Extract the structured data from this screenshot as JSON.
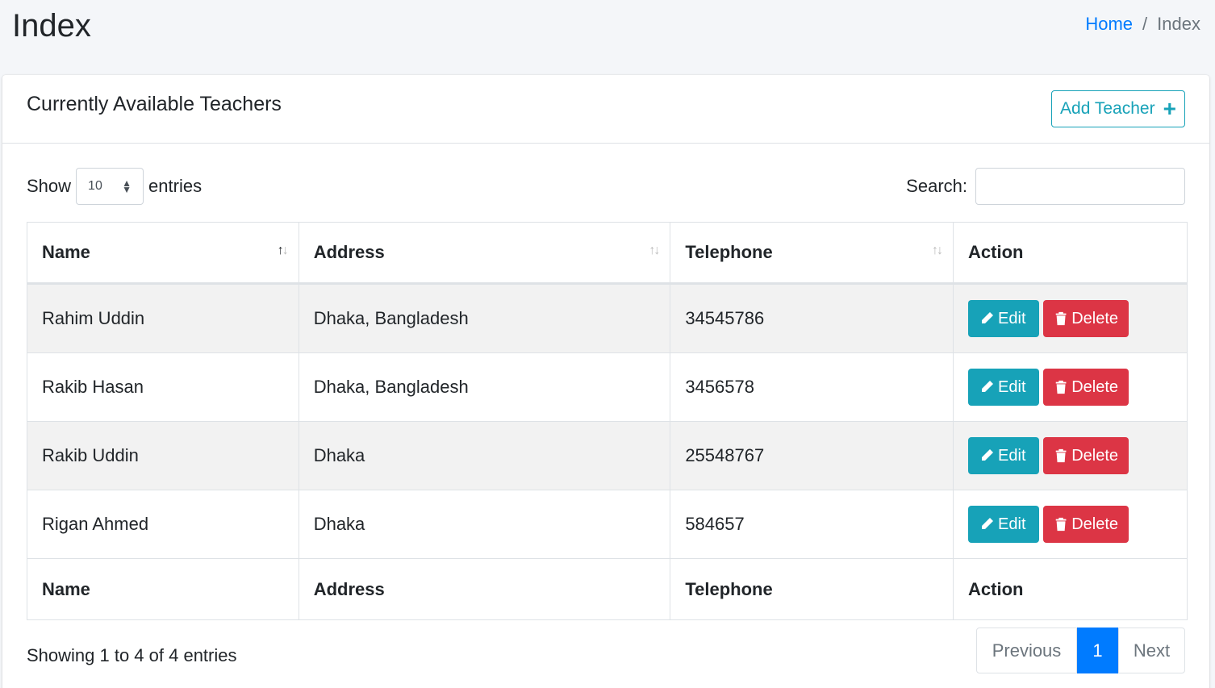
{
  "page": {
    "title": "Index"
  },
  "breadcrumb": {
    "home": "Home",
    "separator": "/",
    "current": "Index"
  },
  "card": {
    "title": "Currently Available Teachers",
    "add_button": "Add Teacher",
    "add_icon": "plus-icon"
  },
  "controls": {
    "show_label": "Show",
    "entries_value": "10",
    "entries_label": "entries",
    "search_label": "Search:",
    "search_value": ""
  },
  "table": {
    "columns": [
      "Name",
      "Address",
      "Telephone",
      "Action"
    ],
    "sort": {
      "column": "Name",
      "direction": "ascending"
    },
    "rows": [
      {
        "name": "Rahim Uddin",
        "address": "Dhaka, Bangladesh",
        "telephone": "34545786"
      },
      {
        "name": "Rakib Hasan",
        "address": "Dhaka, Bangladesh",
        "telephone": "3456578"
      },
      {
        "name": "Rakib Uddin",
        "address": "Dhaka",
        "telephone": "25548767"
      },
      {
        "name": "Rigan Ahmed",
        "address": "Dhaka",
        "telephone": "584657"
      }
    ],
    "edit_label": "Edit",
    "delete_label": "Delete"
  },
  "footer": {
    "info": "Showing 1 to 4 of 4 entries",
    "prev": "Previous",
    "current_page": "1",
    "next": "Next"
  },
  "colors": {
    "primary": "#007bff",
    "info": "#17a2b8",
    "danger": "#dc3545",
    "background": "#f4f6f9"
  }
}
